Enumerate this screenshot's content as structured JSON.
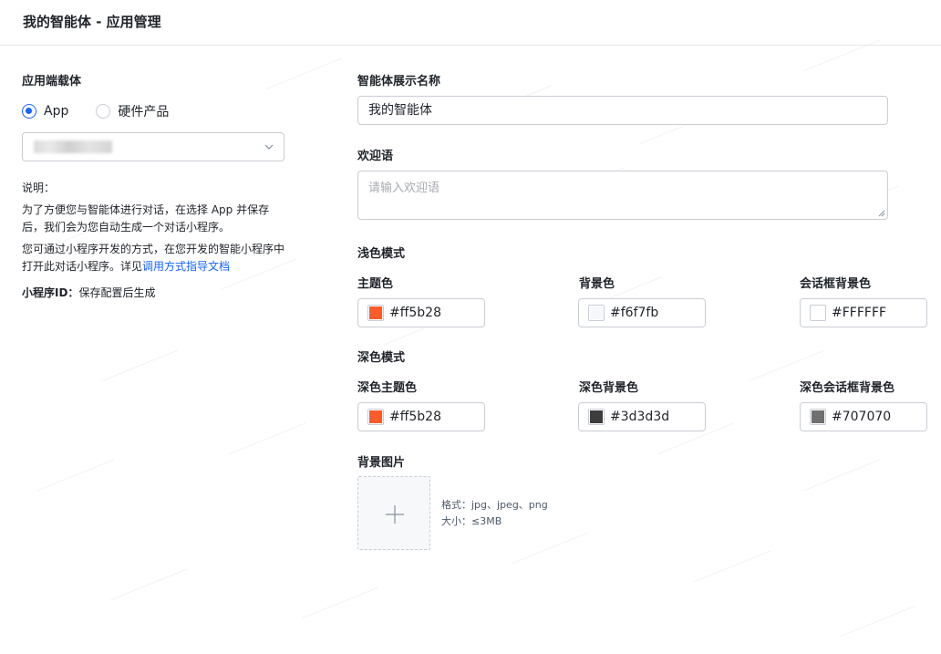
{
  "header": {
    "title": "我的智能体 - 应用管理"
  },
  "left": {
    "carrier_label": "应用端载体",
    "radios": [
      {
        "label": "App",
        "checked": true
      },
      {
        "label": "硬件产品",
        "checked": false
      }
    ],
    "description": {
      "title": "说明：",
      "line1": "为了方便您与智能体进行对话，在选择 App 并保存",
      "line2": "后，我们会为您自动生成一个对话小程序。",
      "line3": "您可通过小程序开发的方式，在您开发的智能小程序中",
      "line4_prefix": "打开此对话小程序。详见",
      "line4_link": "调用方式指导文档"
    },
    "mini_id": {
      "label": "小程序ID：",
      "value": "保存配置后生成"
    }
  },
  "form": {
    "display_name": {
      "label": "智能体展示名称",
      "value": "我的智能体"
    },
    "welcome": {
      "label": "欢迎语",
      "placeholder": "请输入欢迎语"
    },
    "light_mode": {
      "title": "浅色模式",
      "fields": [
        {
          "label": "主题色",
          "value": "#ff5b28",
          "color": "#ff5b28"
        },
        {
          "label": "背景色",
          "value": "#f6f7fb",
          "color": "#f6f7fb"
        },
        {
          "label": "会话框背景色",
          "value": "#FFFFFF",
          "color": "#FFFFFF"
        }
      ]
    },
    "dark_mode": {
      "title": "深色模式",
      "fields": [
        {
          "label": "深色主题色",
          "value": "#ff5b28",
          "color": "#ff5b28"
        },
        {
          "label": "深色背景色",
          "value": "#3d3d3d",
          "color": "#3d3d3d"
        },
        {
          "label": "深色会话框背景色",
          "value": "#707070",
          "color": "#707070"
        }
      ]
    },
    "bg_image": {
      "label": "背景图片",
      "format": "格式：jpg、jpeg、png",
      "size": "大小：≤3MB"
    }
  },
  "colors": {
    "accent": "#1664ff",
    "border": "#c9cdd4"
  }
}
